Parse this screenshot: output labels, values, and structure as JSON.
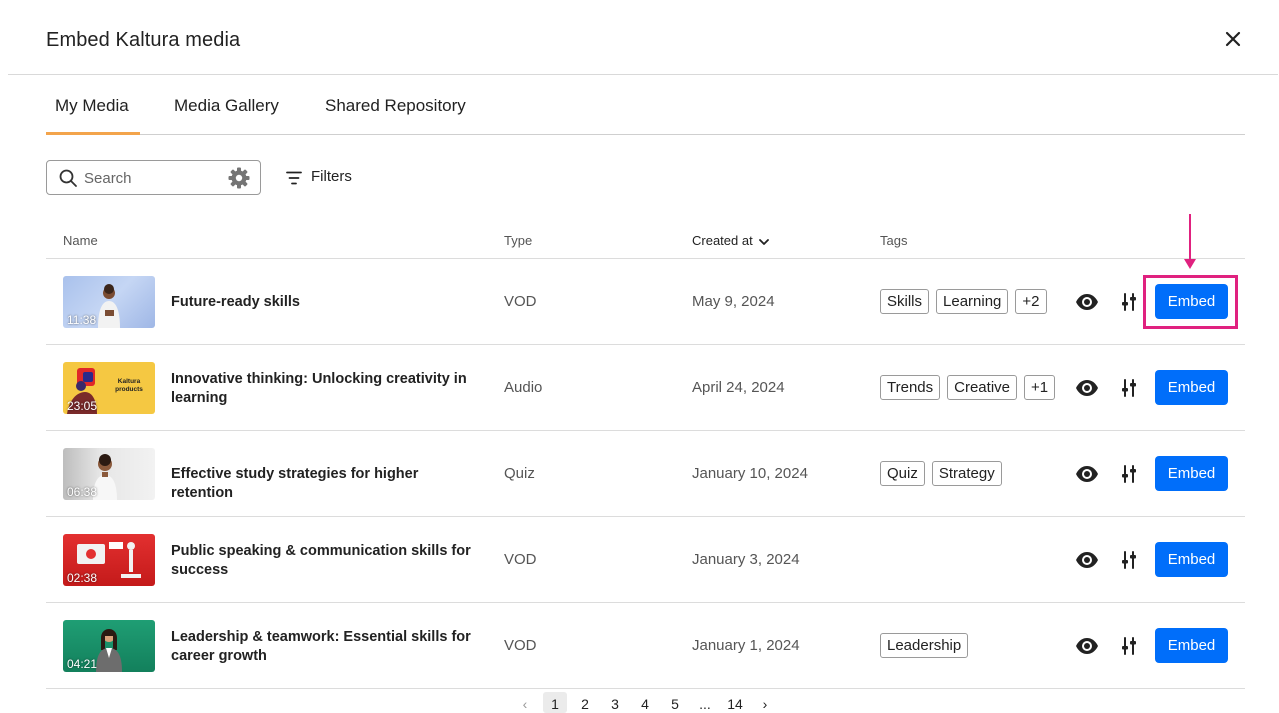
{
  "dialog": {
    "title": "Embed Kaltura media",
    "close_icon": "close-icon"
  },
  "tabs": [
    {
      "label": "My Media",
      "active": true
    },
    {
      "label": "Media Gallery",
      "active": false
    },
    {
      "label": "Shared Repository",
      "active": false
    }
  ],
  "toolbar": {
    "search_placeholder": "Search",
    "search_value": "",
    "filters_label": "Filters",
    "icons": [
      "search-icon",
      "gear-icon",
      "filter-icon"
    ]
  },
  "table": {
    "columns": [
      "Name",
      "Type",
      "Created at",
      "Tags"
    ],
    "sort_column": "Created at",
    "rows": [
      {
        "duration": "11:38",
        "title_lines": [
          "Future-ready skills",
          ""
        ],
        "type": "VOD",
        "created": "May 9, 2024",
        "tags": [
          "Skills",
          "Learning",
          "+2"
        ],
        "embed_label": "Embed"
      },
      {
        "duration": "23:05",
        "thumb_text": "Kaltura products",
        "title_lines": [
          "Innovative thinking: Unlocking creativity in",
          "learning"
        ],
        "type": "Audio",
        "created": "April 24, 2024",
        "tags": [
          "Trends",
          "Creative",
          "+1"
        ],
        "embed_label": "Embed"
      },
      {
        "duration": "06:38",
        "title_lines": [
          "Effective study strategies for higher retention",
          ""
        ],
        "type": "Quiz",
        "created": "January 10, 2024",
        "tags": [
          "Quiz",
          "Strategy"
        ],
        "embed_label": "Embed"
      },
      {
        "duration": "02:38",
        "title_lines": [
          "Public speaking & communication skills for",
          "success"
        ],
        "type": "VOD",
        "created": "January 3, 2024",
        "tags": [],
        "embed_label": "Embed"
      },
      {
        "duration": "04:21",
        "title_lines": [
          "Leadership & teamwork: Essential skills for",
          "career growth"
        ],
        "type": "VOD",
        "created": "January 1, 2024",
        "tags": [
          "Leadership"
        ],
        "embed_label": "Embed"
      }
    ]
  },
  "pagination": {
    "prev": "‹",
    "pages": [
      "1",
      "2",
      "3",
      "4",
      "5",
      "...",
      "14"
    ],
    "current": "1",
    "next": "›"
  },
  "colors": {
    "accent_tab": "#f3a44b",
    "embed_button": "#006efa",
    "highlight": "#e0217f"
  }
}
